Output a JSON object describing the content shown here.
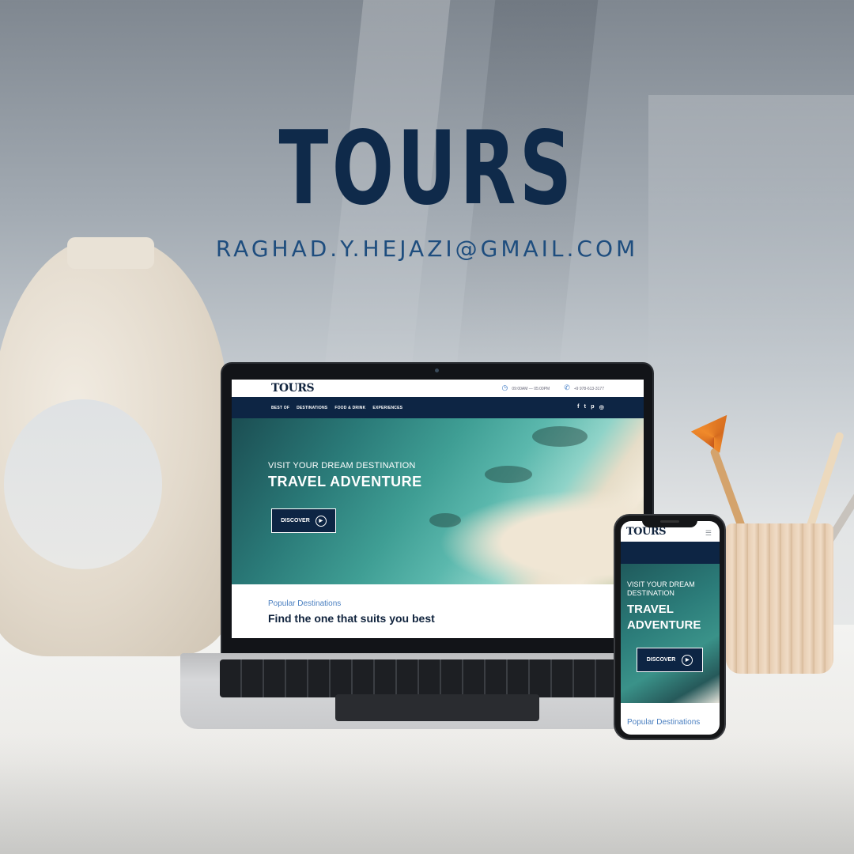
{
  "banner": {
    "title": "TOURS",
    "email": "RAGHAD.Y.HEJAZI@GMAIL.COM"
  },
  "desktop_site": {
    "logo": "TOURS",
    "hours": "09:00AM — 05:00PM",
    "phone": "+9 978-613-3177",
    "nav": [
      "BEST OF",
      "DESTINATIONS",
      "FOOD & DRINK",
      "EXPERIENCES"
    ],
    "social_icons": [
      "facebook-icon",
      "twitter-icon",
      "pinterest-icon",
      "instagram-icon"
    ],
    "hero_subtitle": "VISIT YOUR DREAM DESTINATION",
    "hero_title": "TRAVEL ADVENTURE",
    "cta_label": "DISCOVER",
    "section_subtitle": "Popular Destinations",
    "section_title": "Find the one that suits you best"
  },
  "mobile_site": {
    "logo": "TOURS",
    "hero_subtitle": "VISIT YOUR DREAM DESTINATION",
    "hero_title": "TRAVEL ADVENTURE",
    "cta_label": "DISCOVER",
    "section_subtitle": "Popular Destinations"
  },
  "colors": {
    "brand_navy": "#0d2544",
    "accent_blue": "#4a7fc0",
    "headline": "#0f2a4a"
  }
}
